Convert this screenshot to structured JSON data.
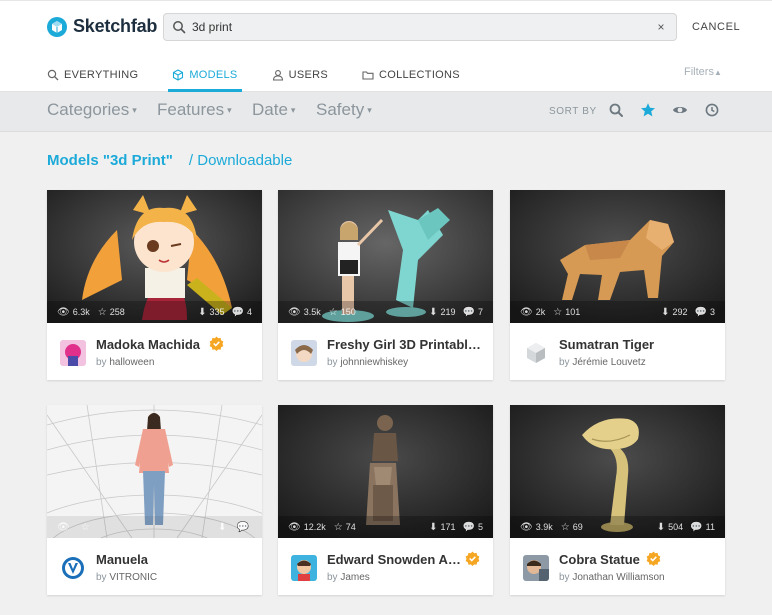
{
  "header": {
    "logo_text": "Sketchfab",
    "search_value": "3d print",
    "clear_glyph": "×",
    "cancel_label": "CANCEL"
  },
  "tabs": [
    {
      "label": "EVERYTHING",
      "icon": "search-icon",
      "active": false
    },
    {
      "label": "MODELS",
      "icon": "cube-icon",
      "active": true
    },
    {
      "label": "USERS",
      "icon": "user-icon",
      "active": false
    },
    {
      "label": "COLLECTIONS",
      "icon": "folder-icon",
      "active": false
    }
  ],
  "filters_label": "Filters",
  "filterbar": {
    "dropdowns": [
      "Categories",
      "Features",
      "Date",
      "Safety"
    ],
    "caret": "▾",
    "sort_label": "SORT BY",
    "sort_options": [
      "search-icon",
      "star-icon",
      "eye-icon",
      "clock-icon"
    ],
    "active_sort": "star-icon"
  },
  "heading": {
    "title": "Models \"3d Print\"",
    "subtitle": "/ Downloadable"
  },
  "colors": {
    "accent": "#1caad9",
    "badge": "#f5a623"
  },
  "models": [
    {
      "title": "Madoka Machida",
      "by": "by",
      "author": "halloween",
      "views": "6.3k",
      "likes": "258",
      "downloads": "335",
      "comments": "4",
      "badge": true
    },
    {
      "title": "Freshy Girl 3D Printabl…",
      "by": "by",
      "author": "johnniewhiskey",
      "views": "3.5k",
      "likes": "150",
      "downloads": "219",
      "comments": "7",
      "badge": false
    },
    {
      "title": "Sumatran Tiger",
      "by": "by",
      "author": "Jérémie Louvetz",
      "views": "2k",
      "likes": "101",
      "downloads": "292",
      "comments": "3",
      "badge": false
    },
    {
      "title": "Manuela",
      "by": "by",
      "author": "VITRONIC",
      "views": "",
      "likes": "",
      "downloads": "",
      "comments": "",
      "badge": false
    },
    {
      "title": "Edward Snowden A…",
      "by": "by",
      "author": "James",
      "views": "12.2k",
      "likes": "74",
      "downloads": "171",
      "comments": "5",
      "badge": true
    },
    {
      "title": "Cobra Statue",
      "by": "by",
      "author": "Jonathan Williamson",
      "views": "3.9k",
      "likes": "69",
      "downloads": "504",
      "comments": "11",
      "badge": true
    }
  ]
}
